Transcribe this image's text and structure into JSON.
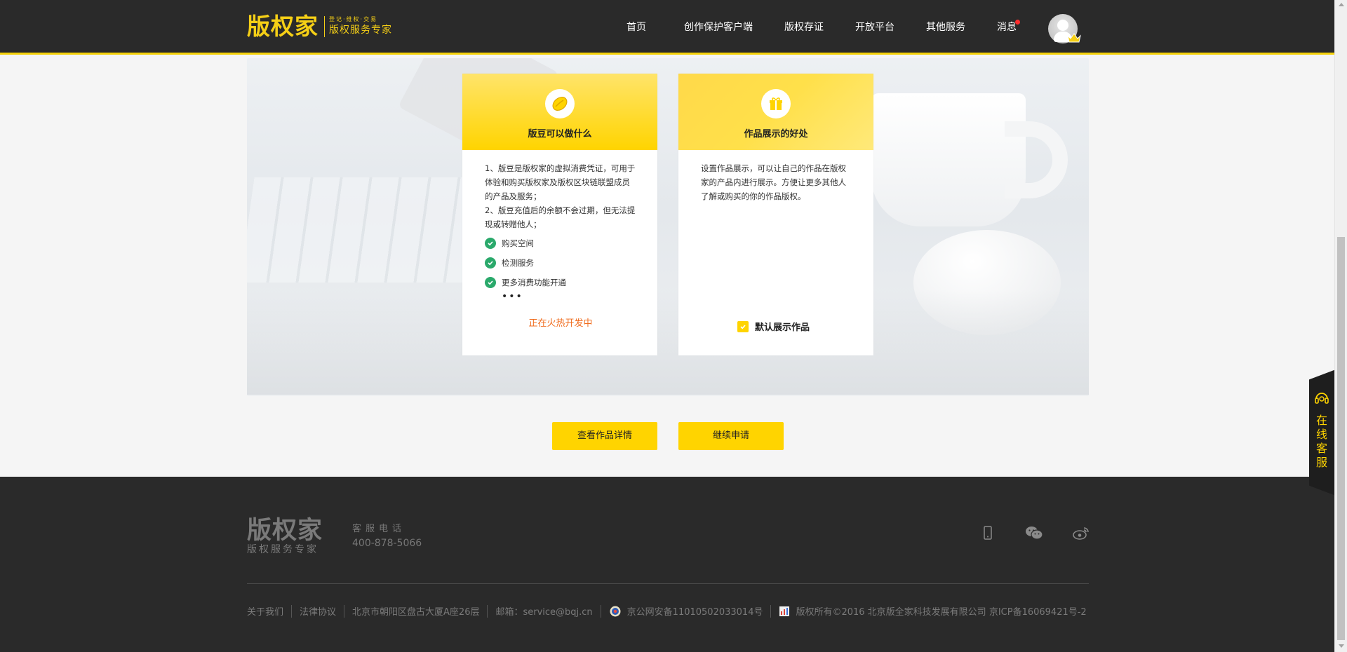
{
  "header": {
    "logo_main": "版权家",
    "logo_tags": "登记·维权·交易",
    "logo_sub": "版权服务专家",
    "nav": [
      {
        "id": "home",
        "label": "首页"
      },
      {
        "id": "client",
        "label": "创作保护客户端"
      },
      {
        "id": "evidence",
        "label": "版权存证"
      },
      {
        "id": "open",
        "label": "开放平台"
      },
      {
        "id": "other",
        "label": "其他服务"
      },
      {
        "id": "message",
        "label": "消息"
      }
    ],
    "has_unread_message": true
  },
  "panels": {
    "beans": {
      "icon": "bean-icon",
      "title": "版豆可以做什么",
      "desc1": "1、版豆是版权家的虚拟消费凭证，可用于体验和购买版权家及版权区块链联盟成员的产品及服务；",
      "desc2": "2、版豆充值后的余额不会过期，但无法提现或转赠他人；",
      "items": [
        "购买空间",
        "检测服务",
        "更多消费功能开通"
      ],
      "more": "•••",
      "note": "正在火热开发中"
    },
    "showcase": {
      "icon": "gift-icon",
      "title": "作品展示的好处",
      "desc": "设置作品展示，可以让自己的作品在版权家的产品内进行展示。方便让更多其他人了解或购买的你的作品版权。",
      "checkbox_label": "默认展示作品",
      "checkbox_checked": true
    }
  },
  "actions": {
    "view_detail": "查看作品详情",
    "continue_apply": "继续申请"
  },
  "footer": {
    "logo_main": "版权家",
    "logo_sub": "版权服务专家",
    "phone_label": "客服电话",
    "phone": "400-878-5066",
    "social_icons": [
      "mobile-icon",
      "wechat-icon",
      "weibo-icon"
    ],
    "links": {
      "about": "关于我们",
      "legal": "法律协议",
      "address": "北京市朝阳区盘古大厦A座26层",
      "email": "邮箱：service@bqj.cn",
      "police": "京公网安备11010502033014号",
      "copyright": "版权所有©2016  北京版全家科技发展有限公司  京ICP备16069421号-2"
    }
  },
  "service_float": {
    "label": "在线客服"
  },
  "colors": {
    "brand_yellow": "#ffd400",
    "header_bg": "#2a2a2a",
    "check_green": "#2aa96b",
    "note_orange": "#f06c1e"
  }
}
